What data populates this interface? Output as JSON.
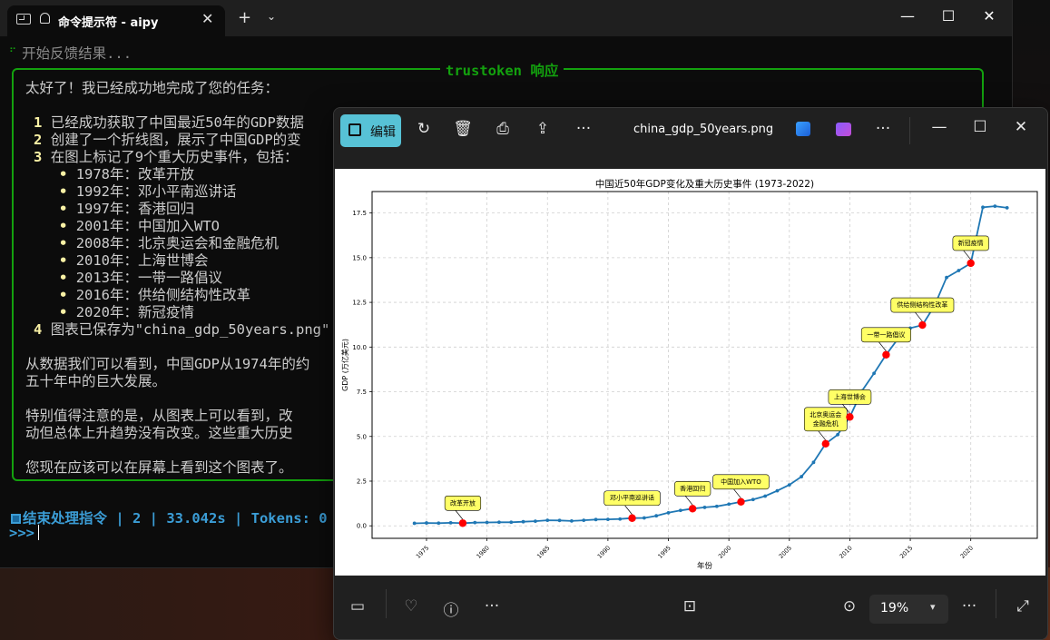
{
  "terminal": {
    "tab_title": "命令提示符 - aipy",
    "status": "开始反馈结果...",
    "panel_title": "trustoken 响应",
    "intro": "太好了！我已经成功地完成了您的任务：",
    "items": [
      {
        "n": "1",
        "text": "已经成功获取了中国最近50年的GDP数据"
      },
      {
        "n": "2",
        "text": "创建了一个折线图，展示了中国GDP的变"
      },
      {
        "n": "3",
        "text": "在图上标记了9个重大历史事件，包括："
      }
    ],
    "events": [
      "1978年：改革开放",
      "1992年：邓小平南巡讲话",
      "1997年：香港回归",
      "2001年：中国加入WTO",
      "2008年：北京奥运会和金融危机",
      "2010年：上海世博会",
      "2013年：一带一路倡议",
      "2016年：供给侧结构性改革",
      "2020年：新冠疫情"
    ],
    "item4": {
      "n": "4",
      "text": "图表已保存为\"china_gdp_50years.png\""
    },
    "para1_line1": "从数据我们可以看到，中国GDP从1974年的约",
    "para1_line2": "五十年中的巨大发展。",
    "para2_line1": "特别值得注意的是，从图表上可以看到，改",
    "para2_line2": "动但总体上升趋势没有改变。这些重大历史",
    "closing": "您现在应该可以在屏幕上看到这个图表了。",
    "footer": "结束处理指令 | 2 | 33.042s | Tokens: 0",
    "prompt": ">>>"
  },
  "photos": {
    "edit_label": "编辑",
    "filename": "china_gdp_50years.png",
    "zoom": "19%"
  },
  "colors": {
    "terminal_green": "#13a10e",
    "terminal_yellow": "#f9f1a5",
    "terminal_blue": "#3b9dd6",
    "edit_button": "#57c2d6",
    "line": "#1f77b4",
    "event_marker": "#ff0000",
    "annotation_fill": "#ffff66"
  },
  "icons": [
    "terminal-icon",
    "bell-icon",
    "close-icon",
    "plus-icon",
    "chevron-down-icon",
    "minimize-icon",
    "maximize-icon",
    "edit-icon",
    "rotate-icon",
    "trash-icon",
    "print-icon",
    "share-icon",
    "more-icon",
    "pencil-app-icon",
    "clipchamp-icon",
    "filmstrip-icon",
    "heart-icon",
    "info-icon",
    "focus-icon",
    "fit-icon",
    "expand-icon"
  ],
  "chart_data": {
    "type": "line",
    "title": "中国近50年GDP变化及重大历史事件 (1973-2022)",
    "xlabel": "年份",
    "ylabel": "GDP (万亿美元)",
    "xlim": [
      1970.5,
      2025.5
    ],
    "ylim": [
      -0.7,
      18.7
    ],
    "xticks": [
      1975,
      1980,
      1985,
      1990,
      1995,
      2000,
      2005,
      2010,
      2015,
      2020
    ],
    "yticks": [
      0.0,
      2.5,
      5.0,
      7.5,
      10.0,
      12.5,
      15.0,
      17.5
    ],
    "grid": true,
    "x": [
      1974,
      1975,
      1976,
      1977,
      1978,
      1979,
      1980,
      1981,
      1982,
      1983,
      1984,
      1985,
      1986,
      1987,
      1988,
      1989,
      1990,
      1991,
      1992,
      1993,
      1994,
      1995,
      1996,
      1997,
      1998,
      1999,
      2000,
      2001,
      2002,
      2003,
      2004,
      2005,
      2006,
      2007,
      2008,
      2009,
      2010,
      2011,
      2012,
      2013,
      2014,
      2015,
      2016,
      2017,
      2018,
      2019,
      2020,
      2021,
      2022,
      2023
    ],
    "y": [
      0.14,
      0.16,
      0.15,
      0.17,
      0.15,
      0.18,
      0.19,
      0.2,
      0.2,
      0.23,
      0.26,
      0.31,
      0.3,
      0.27,
      0.31,
      0.35,
      0.36,
      0.38,
      0.43,
      0.44,
      0.56,
      0.73,
      0.86,
      0.96,
      1.03,
      1.09,
      1.21,
      1.34,
      1.47,
      1.66,
      1.96,
      2.29,
      2.75,
      3.55,
      4.59,
      5.1,
      6.09,
      7.55,
      8.53,
      9.57,
      10.48,
      11.06,
      11.23,
      12.31,
      13.89,
      14.28,
      14.69,
      17.82,
      17.88,
      17.79
    ],
    "events": [
      {
        "year": 1978,
        "value": 0.15,
        "label": "改革开放"
      },
      {
        "year": 1992,
        "value": 0.43,
        "label": "邓小平南巡讲话"
      },
      {
        "year": 1997,
        "value": 0.96,
        "label": "香港回归"
      },
      {
        "year": 2001,
        "value": 1.34,
        "label": "中国加入WTO"
      },
      {
        "year": 2008,
        "value": 4.59,
        "label": "北京奥运会\n金融危机"
      },
      {
        "year": 2010,
        "value": 6.09,
        "label": "上海世博会"
      },
      {
        "year": 2013,
        "value": 9.57,
        "label": "一带一路倡议"
      },
      {
        "year": 2016,
        "value": 11.23,
        "label": "供给侧结构性改革"
      },
      {
        "year": 2020,
        "value": 14.69,
        "label": "新冠疫情"
      }
    ]
  }
}
